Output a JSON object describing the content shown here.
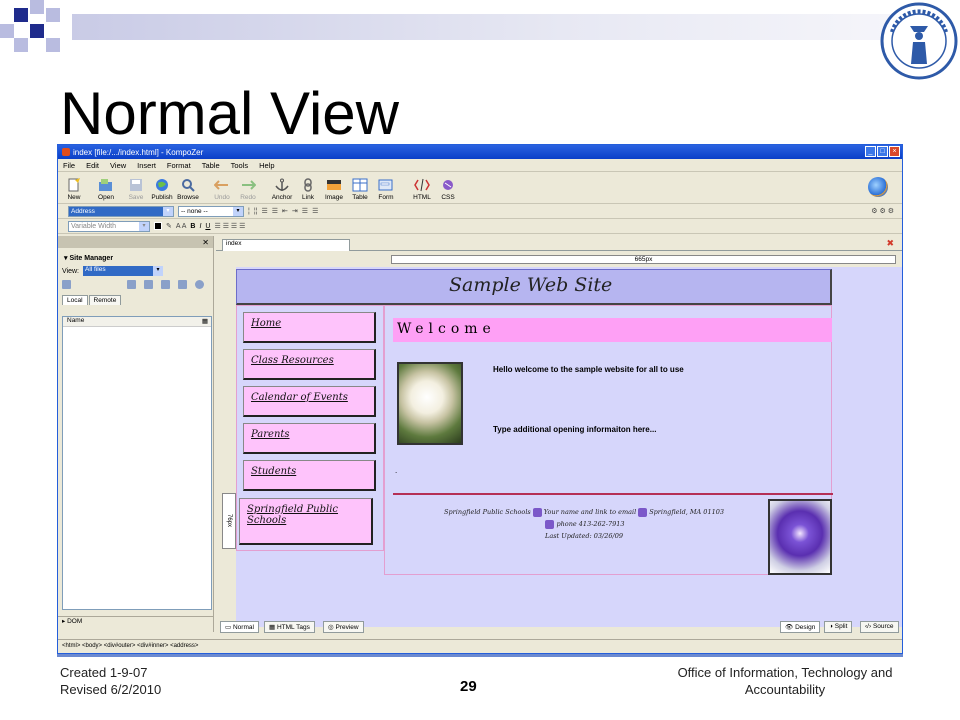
{
  "slide": {
    "title": "Normal View",
    "created": "Created 1-9-07",
    "revised": "Revised 6/2/2010",
    "page_number": "29",
    "office": "Office of Information, Technology and Accountability",
    "colors": {
      "deco_dark": "#1f2b8c",
      "deco_light": "#b9bce0",
      "logo_blue": "#2e5aa8"
    }
  },
  "window": {
    "title": "index [file:/.../index.html] - KompoZer",
    "menu": [
      "File",
      "Edit",
      "View",
      "Insert",
      "Format",
      "Table",
      "Tools",
      "Help"
    ],
    "toolbar": [
      {
        "label": "New",
        "icon": "new-page-icon"
      },
      {
        "label": "Open",
        "icon": "open-icon"
      },
      {
        "label": "Save",
        "icon": "save-icon",
        "disabled": true
      },
      {
        "label": "Publish",
        "icon": "publish-icon"
      },
      {
        "label": "Browse",
        "icon": "browse-icon"
      },
      {
        "label": "Undo",
        "icon": "undo-icon",
        "disabled": true
      },
      {
        "label": "Redo",
        "icon": "redo-icon",
        "disabled": true
      },
      {
        "label": "Anchor",
        "icon": "anchor-icon"
      },
      {
        "label": "Link",
        "icon": "link-icon"
      },
      {
        "label": "Image",
        "icon": "image-icon"
      },
      {
        "label": "Table",
        "icon": "table-icon"
      },
      {
        "label": "Form",
        "icon": "form-icon"
      },
      {
        "label": "HTML",
        "icon": "html-icon"
      },
      {
        "label": "CSS",
        "icon": "css-icon"
      }
    ],
    "format_toolbar": {
      "paragraph_style": "Address",
      "class": "-- none --"
    },
    "font_toolbar": {
      "font": "Variable Width"
    },
    "sidebar": {
      "title": "Site Manager",
      "view_label": "View:",
      "view_value": "All files",
      "tabs": [
        "Local",
        "Remote"
      ],
      "column": "Name",
      "dom_label": "DOM"
    },
    "doc_tab": "index",
    "ruler": "665px",
    "vruler": "76px",
    "mode_tabs": [
      "Normal",
      "HTML Tags",
      "Preview"
    ],
    "view_tabs": [
      "Design",
      "Split",
      "Source"
    ],
    "status": "<html>  <body>  <div#outer>  <div#inner>  <address>"
  },
  "site": {
    "header": "Sample Web Site",
    "nav": [
      "Home",
      "Class Resources",
      "Calendar of Events",
      "Parents",
      "Students",
      "Springfield Public Schools"
    ],
    "welcome": "Welcome",
    "hello": "Hello welcome to the sample website for all to use",
    "additional": "Type additional opening informaiton here...",
    "dot": ".",
    "footer": {
      "line1a": "Springfield Public Schools",
      "line1b": "Your name and link to email",
      "line1c": "Springfield, MA  01103",
      "line2": "phone 413-262-7913",
      "line3": "Last Updated: 03/26/09"
    }
  }
}
